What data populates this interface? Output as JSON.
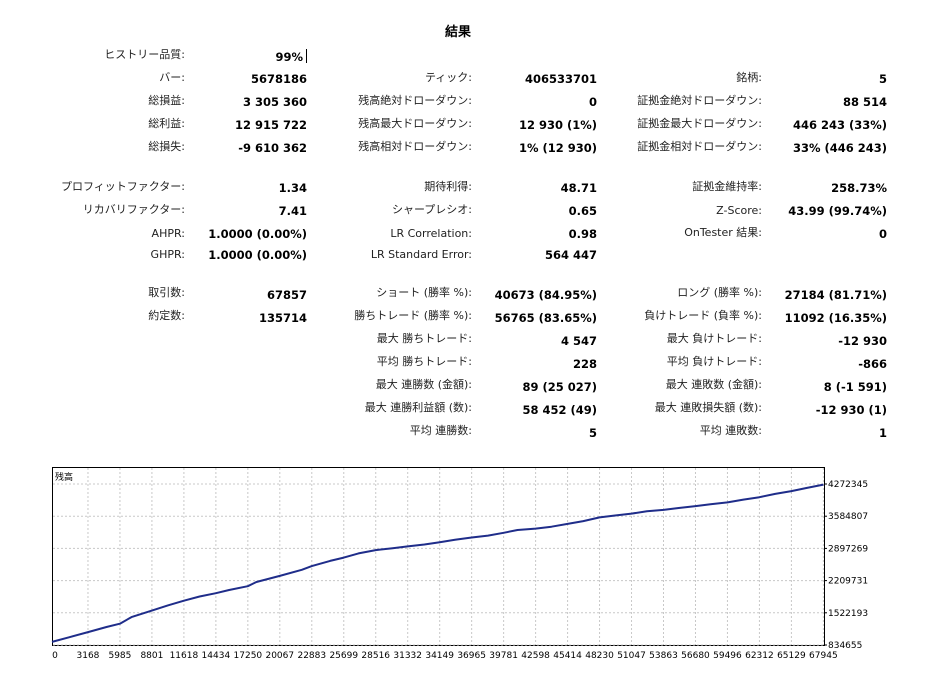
{
  "title": "結果",
  "row_quality": {
    "label": "ヒストリー品質:",
    "value": "99%"
  },
  "row_bars": [
    {
      "label": "バー:",
      "value": "5678186"
    },
    {
      "label": "ティック:",
      "value": "406533701"
    },
    {
      "label": "銘柄:",
      "value": "5"
    }
  ],
  "row_total_net": [
    {
      "label": "総損益:",
      "value": "3 305 360"
    },
    {
      "label": "残高絶対ドローダウン:",
      "value": "0"
    },
    {
      "label": "証拠金絶対ドローダウン:",
      "value": "88 514"
    }
  ],
  "row_gross_profit": [
    {
      "label": "総利益:",
      "value": "12 915 722"
    },
    {
      "label": "残高最大ドローダウン:",
      "value": "12 930 (1%)"
    },
    {
      "label": "証拠金最大ドローダウン:",
      "value": "446 243 (33%)"
    }
  ],
  "row_gross_loss": [
    {
      "label": "総損失:",
      "value": "-9 610 362"
    },
    {
      "label": "残高相対ドローダウン:",
      "value": "1% (12 930)"
    },
    {
      "label": "証拠金相対ドローダウン:",
      "value": "33% (446 243)"
    }
  ],
  "row_profit_factor": [
    {
      "label": "プロフィットファクター:",
      "value": "1.34"
    },
    {
      "label": "期待利得:",
      "value": "48.71"
    },
    {
      "label": "証拠金維持率:",
      "value": "258.73%"
    }
  ],
  "row_recovery": [
    {
      "label": "リカバリファクター:",
      "value": "7.41"
    },
    {
      "label": "シャープレシオ:",
      "value": "0.65"
    },
    {
      "label": "Z-Score:",
      "value": "43.99 (99.74%)"
    }
  ],
  "row_ahpr": [
    {
      "label": "AHPR:",
      "value": "1.0000 (0.00%)"
    },
    {
      "label": "LR Correlation:",
      "value": "0.98"
    },
    {
      "label": "OnTester 結果:",
      "value": "0"
    }
  ],
  "row_ghpr": [
    {
      "label": "GHPR:",
      "value": "1.0000 (0.00%)"
    },
    {
      "label": "LR Standard Error:",
      "value": "564 447"
    }
  ],
  "row_trades": [
    {
      "label": "取引数:",
      "value": "67857"
    },
    {
      "label": "ショート (勝率 %):",
      "value": "40673 (84.95%)"
    },
    {
      "label": "ロング (勝率 %):",
      "value": "27184 (81.71%)"
    }
  ],
  "row_deals": [
    {
      "label": "約定数:",
      "value": "135714"
    },
    {
      "label": "勝ちトレード (勝率 %):",
      "value": "56765 (83.65%)"
    },
    {
      "label": "負けトレード (負率 %):",
      "value": "11092 (16.35%)"
    }
  ],
  "row_largest": [
    {
      "label": "最大 勝ちトレード:",
      "value": "4 547"
    },
    {
      "label": "最大 負けトレード:",
      "value": "-12 930"
    }
  ],
  "row_average": [
    {
      "label": "平均 勝ちトレード:",
      "value": "228"
    },
    {
      "label": "平均 負けトレード:",
      "value": "-866"
    }
  ],
  "row_max_consec": [
    {
      "label": "最大 連勝数 (金額):",
      "value": "89 (25 027)"
    },
    {
      "label": "最大 連敗数 (金額):",
      "value": "8 (-1 591)"
    }
  ],
  "row_max_consec_amount": [
    {
      "label": "最大 連勝利益額 (数):",
      "value": "58 452 (49)"
    },
    {
      "label": "最大 連敗損失額 (数):",
      "value": "-12 930 (1)"
    }
  ],
  "row_avg_consec": [
    {
      "label": "平均 連勝数:",
      "value": "5"
    },
    {
      "label": "平均 連敗数:",
      "value": "1"
    }
  ],
  "chart_data": {
    "type": "line",
    "series_label": "残高",
    "xlabel": "",
    "ylabel": "",
    "x_ticks": [
      "0",
      "3168",
      "5985",
      "8801",
      "11618",
      "14434",
      "17250",
      "20067",
      "22883",
      "25699",
      "28516",
      "31332",
      "34149",
      "36965",
      "39781",
      "42598",
      "45414",
      "48230",
      "51047",
      "53863",
      "56680",
      "59496",
      "62312",
      "65129",
      "67945"
    ],
    "y_ticks": [
      "4272345",
      "3584807",
      "2897269",
      "2209731",
      "1522193",
      "834655"
    ],
    "xlim": [
      0,
      68000
    ],
    "ylim": [
      834655,
      4272345
    ],
    "grid": true,
    "line_color": "#1f2d8a",
    "series": [
      {
        "x": [
          0,
          1500,
          3168,
          4800,
          5985,
          7000,
          8801,
          10200,
          11618,
          13000,
          14434,
          15600,
          17250,
          18000,
          20067,
          22000,
          22883,
          24500,
          25699,
          27000,
          28516,
          30000,
          31332,
          32800,
          34149,
          35500,
          36965,
          38400,
          39781,
          41000,
          42598,
          44000,
          45414,
          46800,
          48230,
          49600,
          51047,
          52400,
          53863,
          55200,
          56680,
          58000,
          59496,
          60900,
          62312,
          63700,
          65129,
          66500,
          67945
        ],
        "y": [
          900000,
          1000000,
          1110000,
          1220000,
          1290000,
          1430000,
          1570000,
          1680000,
          1780000,
          1870000,
          1940000,
          2010000,
          2090000,
          2180000,
          2310000,
          2440000,
          2520000,
          2630000,
          2700000,
          2790000,
          2860000,
          2900000,
          2940000,
          2980000,
          3030000,
          3080000,
          3130000,
          3170000,
          3230000,
          3290000,
          3320000,
          3360000,
          3420000,
          3480000,
          3560000,
          3600000,
          3640000,
          3690000,
          3720000,
          3760000,
          3800000,
          3840000,
          3880000,
          3940000,
          3990000,
          4060000,
          4120000,
          4190000,
          4260000
        ]
      }
    ]
  }
}
